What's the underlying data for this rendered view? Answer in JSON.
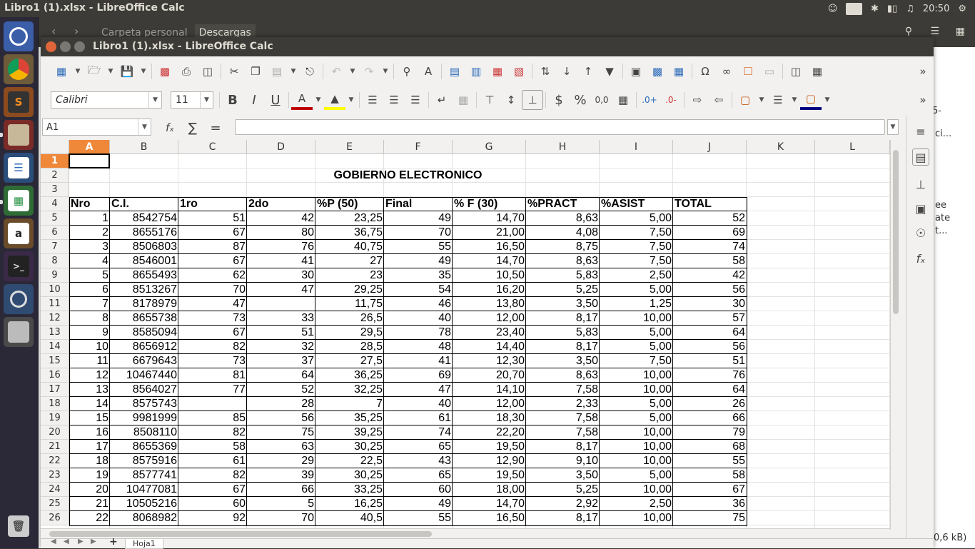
{
  "topbar": {
    "title": "Libro1 (1).xlsx - LibreOffice Calc",
    "keyboard": "Es",
    "time": "20:50"
  },
  "files_window": {
    "tabs": [
      "Carpeta personal",
      "Descargas"
    ],
    "side_texts": [
      "5-",
      "ci...",
      "ee",
      "ate",
      "t...",
      "0,6 kB)"
    ]
  },
  "window": {
    "title": "Libro1 (1).xlsx - LibreOffice Calc"
  },
  "toolbar": {
    "font_name": "Calibri",
    "font_size": "11"
  },
  "formula_bar": {
    "name_box": "A1",
    "formula": ""
  },
  "columns": [
    "A",
    "B",
    "C",
    "D",
    "E",
    "F",
    "G",
    "H",
    "I",
    "J",
    "K",
    "L"
  ],
  "rows": [
    "1",
    "2",
    "3",
    "4",
    "5",
    "6",
    "7",
    "8",
    "9",
    "10",
    "11",
    "12",
    "13",
    "14",
    "15",
    "16",
    "17",
    "18",
    "19",
    "20",
    "21",
    "22",
    "23",
    "24",
    "25",
    "26"
  ],
  "sheet": {
    "title": "GOBIERNO ELECTRONICO",
    "headers": [
      "Nro",
      "C.I.",
      "1ro",
      "2do",
      "%P (50)",
      "Final",
      "% F (30)",
      "%PRACT",
      "%ASIST",
      "TOTAL"
    ],
    "data": [
      [
        "1",
        "8542754",
        "51",
        "42",
        "23,25",
        "49",
        "14,70",
        "8,63",
        "5,00",
        "52"
      ],
      [
        "2",
        "8655176",
        "67",
        "80",
        "36,75",
        "70",
        "21,00",
        "4,08",
        "7,50",
        "69"
      ],
      [
        "3",
        "8506803",
        "87",
        "76",
        "40,75",
        "55",
        "16,50",
        "8,75",
        "7,50",
        "74"
      ],
      [
        "4",
        "8546001",
        "67",
        "41",
        "27",
        "49",
        "14,70",
        "8,63",
        "7,50",
        "58"
      ],
      [
        "5",
        "8655493",
        "62",
        "30",
        "23",
        "35",
        "10,50",
        "5,83",
        "2,50",
        "42"
      ],
      [
        "6",
        "8513267",
        "70",
        "47",
        "29,25",
        "54",
        "16,20",
        "5,25",
        "5,00",
        "56"
      ],
      [
        "7",
        "8178979",
        "47",
        "",
        "11,75",
        "46",
        "13,80",
        "3,50",
        "1,25",
        "30"
      ],
      [
        "8",
        "8655738",
        "73",
        "33",
        "26,5",
        "40",
        "12,00",
        "8,17",
        "10,00",
        "57"
      ],
      [
        "9",
        "8585094",
        "67",
        "51",
        "29,5",
        "78",
        "23,40",
        "5,83",
        "5,00",
        "64"
      ],
      [
        "10",
        "8656912",
        "82",
        "32",
        "28,5",
        "48",
        "14,40",
        "8,17",
        "5,00",
        "56"
      ],
      [
        "11",
        "6679643",
        "73",
        "37",
        "27,5",
        "41",
        "12,30",
        "3,50",
        "7,50",
        "51"
      ],
      [
        "12",
        "10467440",
        "81",
        "64",
        "36,25",
        "69",
        "20,70",
        "8,63",
        "10,00",
        "76"
      ],
      [
        "13",
        "8564027",
        "77",
        "52",
        "32,25",
        "47",
        "14,10",
        "7,58",
        "10,00",
        "64"
      ],
      [
        "14",
        "8575743",
        "",
        "28",
        "7",
        "40",
        "12,00",
        "2,33",
        "5,00",
        "26"
      ],
      [
        "15",
        "9981999",
        "85",
        "56",
        "35,25",
        "61",
        "18,30",
        "7,58",
        "5,00",
        "66"
      ],
      [
        "16",
        "8508110",
        "82",
        "75",
        "39,25",
        "74",
        "22,20",
        "7,58",
        "10,00",
        "79"
      ],
      [
        "17",
        "8655369",
        "58",
        "63",
        "30,25",
        "65",
        "19,50",
        "8,17",
        "10,00",
        "68"
      ],
      [
        "18",
        "8575916",
        "61",
        "29",
        "22,5",
        "43",
        "12,90",
        "9,10",
        "10,00",
        "55"
      ],
      [
        "19",
        "8577741",
        "82",
        "39",
        "30,25",
        "65",
        "19,50",
        "3,50",
        "5,00",
        "58"
      ],
      [
        "20",
        "10477081",
        "67",
        "66",
        "33,25",
        "60",
        "18,00",
        "5,25",
        "10,00",
        "67"
      ],
      [
        "21",
        "10505216",
        "60",
        "5",
        "16,25",
        "49",
        "14,70",
        "2,92",
        "2,50",
        "36"
      ],
      [
        "22",
        "8068982",
        "92",
        "70",
        "40,5",
        "55",
        "16,50",
        "8,17",
        "10,00",
        "75"
      ]
    ]
  },
  "sheet_tab": "Hoja1"
}
